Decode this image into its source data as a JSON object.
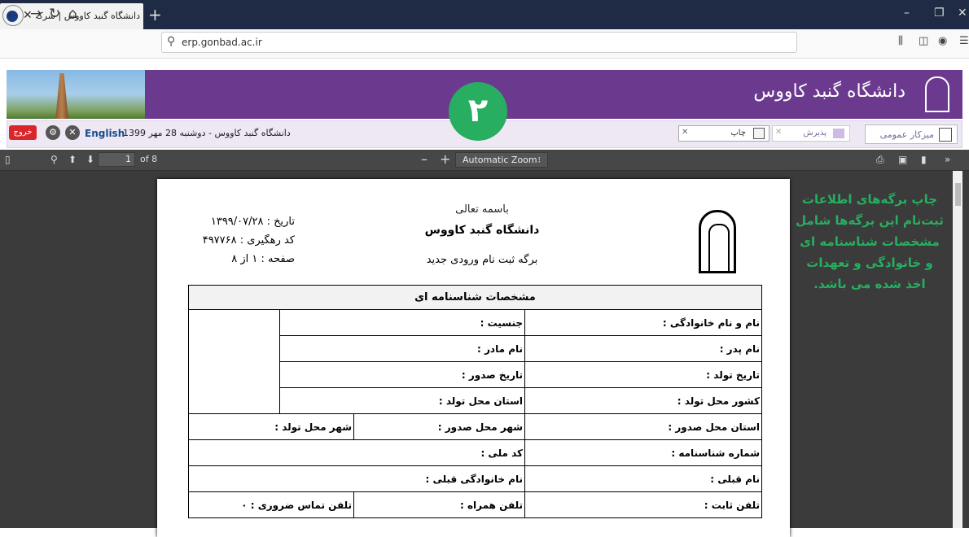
{
  "browser": {
    "tab_title": "دانشگاه گنبد کاووس | شرکت سا...",
    "tab_close": "✕",
    "new_tab": "+",
    "url": "erp.gonbad.ac.ir",
    "win_min": "–",
    "win_max": "❐",
    "win_close": "✕"
  },
  "header": {
    "logo_text": "دانشگاه گنبد کاووس"
  },
  "badge": {
    "number": "۲"
  },
  "infobar": {
    "exit_label": "خروج",
    "english_label": "English",
    "date_text": "دانشگاه گنبد کاووس - دوشنبه 28 مهر 1399",
    "print_label": "چاپ",
    "admission_label": "پذیرش",
    "desk_label": "میزکار عمومی"
  },
  "pdf_toolbar": {
    "page_value": "1",
    "page_total": "of 8",
    "zoom": "Automatic Zoom",
    "minus": "–",
    "plus": "+"
  },
  "document": {
    "basmala": "باسمه تعالی",
    "university": "دانشگاه گنبد کاووس",
    "form_title": "برگه ثبت نام ورودی جدید",
    "date_line": "تاریخ : ۱۳۹۹/۰۷/۲۸",
    "tracking_line": "کد رهگیری : ۴۹۷۷۶۸",
    "page_line": "صفحه : ۱ از ۸",
    "section_title": "مشخصات شناسنامه ای",
    "fields": {
      "full_name": "نام و نام خانوادگی :",
      "gender": "جنسیت :",
      "father_name": "نام پدر :",
      "mother_name": "نام مادر :",
      "birth_date": "تاریخ تولد :",
      "issue_date": "تاریخ صدور :",
      "birth_country": "کشور محل تولد :",
      "birth_province": "استان محل تولد :",
      "issue_province": "استان محل صدور :",
      "issue_city": "شهر محل صدور :",
      "birth_city": "شهر محل تولد :",
      "id_number": "شماره شناسنامه :",
      "national_code": "کد ملی :",
      "prev_family": "نام خانوادگی قبلی :",
      "prev_name": "نام قبلی :",
      "landline": "تلفن ثابت :",
      "mobile": "تلفن همراه :",
      "emergency": "تلفن تماس ضروری : ۰"
    }
  },
  "annotation": "چاپ برگه‌های اطلاعات ثبت‌نام این برگه‌ها شامل مشخصات شناسنامه ای و خانوادگی و تعهدات اخذ شده می باشد."
}
